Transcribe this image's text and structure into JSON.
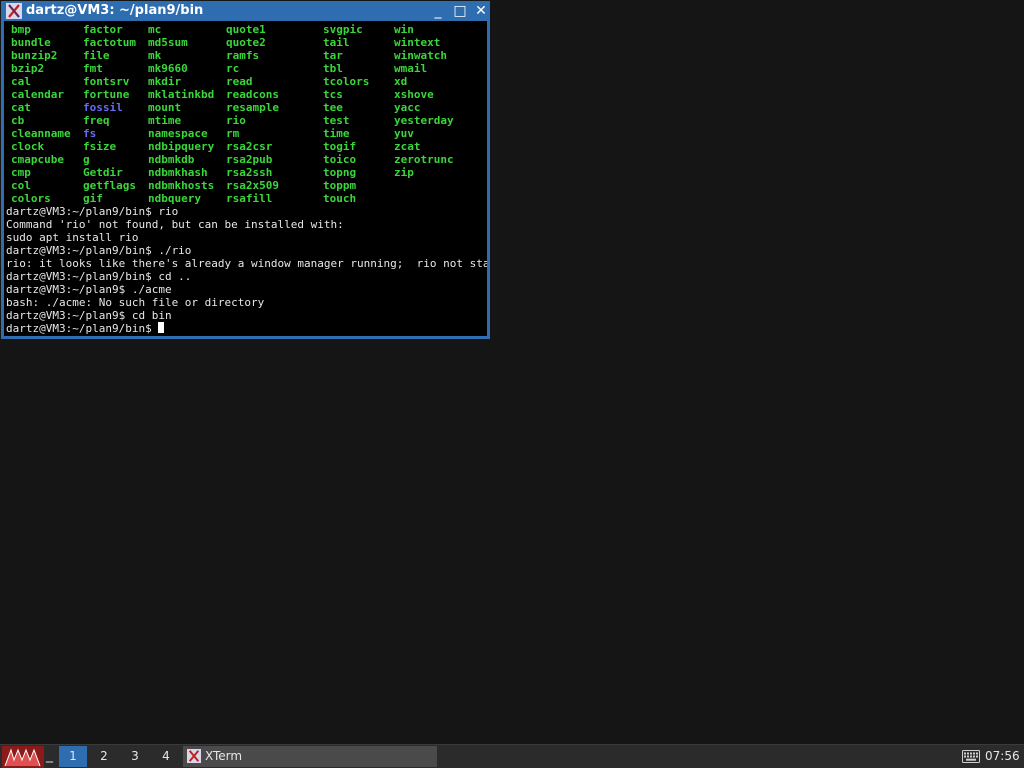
{
  "window": {
    "title": "dartz@VM3: ~/plan9/bin",
    "bg_color": "#2f6db1",
    "minimize_glyph": "_",
    "maximize_glyph": "□",
    "close_glyph": "✕"
  },
  "terminal": {
    "ls_columns": [
      [
        {
          "name": "bmp",
          "color": "#3ad63a"
        },
        {
          "name": "bundle",
          "color": "#3ad63a"
        },
        {
          "name": "bunzip2",
          "color": "#3ad63a"
        },
        {
          "name": "bzip2",
          "color": "#3ad63a"
        },
        {
          "name": "cal",
          "color": "#3ad63a"
        },
        {
          "name": "calendar",
          "color": "#3ad63a"
        },
        {
          "name": "cat",
          "color": "#3ad63a"
        },
        {
          "name": "cb",
          "color": "#3ad63a"
        },
        {
          "name": "cleanname",
          "color": "#3ad63a"
        },
        {
          "name": "clock",
          "color": "#3ad63a"
        },
        {
          "name": "cmapcube",
          "color": "#3ad63a"
        },
        {
          "name": "cmp",
          "color": "#3ad63a"
        },
        {
          "name": "col",
          "color": "#3ad63a"
        },
        {
          "name": "colors",
          "color": "#3ad63a"
        }
      ],
      [
        {
          "name": "factor",
          "color": "#3ad63a"
        },
        {
          "name": "factotum",
          "color": "#3ad63a"
        },
        {
          "name": "file",
          "color": "#3ad63a"
        },
        {
          "name": "fmt",
          "color": "#3ad63a"
        },
        {
          "name": "fontsrv",
          "color": "#3ad63a"
        },
        {
          "name": "fortune",
          "color": "#3ad63a"
        },
        {
          "name": "fossil",
          "color": "#6a6af0"
        },
        {
          "name": "freq",
          "color": "#3ad63a"
        },
        {
          "name": "fs",
          "color": "#6a6af0"
        },
        {
          "name": "fsize",
          "color": "#3ad63a"
        },
        {
          "name": "g",
          "color": "#3ad63a"
        },
        {
          "name": "Getdir",
          "color": "#3ad63a"
        },
        {
          "name": "getflags",
          "color": "#3ad63a"
        },
        {
          "name": "gif",
          "color": "#3ad63a"
        }
      ],
      [
        {
          "name": "mc",
          "color": "#3ad63a"
        },
        {
          "name": "md5sum",
          "color": "#3ad63a"
        },
        {
          "name": "mk",
          "color": "#3ad63a"
        },
        {
          "name": "mk9660",
          "color": "#3ad63a"
        },
        {
          "name": "mkdir",
          "color": "#3ad63a"
        },
        {
          "name": "mklatinkbd",
          "color": "#3ad63a"
        },
        {
          "name": "mount",
          "color": "#3ad63a"
        },
        {
          "name": "mtime",
          "color": "#3ad63a"
        },
        {
          "name": "namespace",
          "color": "#3ad63a"
        },
        {
          "name": "ndbipquery",
          "color": "#3ad63a"
        },
        {
          "name": "ndbmkdb",
          "color": "#3ad63a"
        },
        {
          "name": "ndbmkhash",
          "color": "#3ad63a"
        },
        {
          "name": "ndbmkhosts",
          "color": "#3ad63a"
        },
        {
          "name": "ndbquery",
          "color": "#3ad63a"
        }
      ],
      [
        {
          "name": "quote1",
          "color": "#3ad63a"
        },
        {
          "name": "quote2",
          "color": "#3ad63a"
        },
        {
          "name": "ramfs",
          "color": "#3ad63a"
        },
        {
          "name": "rc",
          "color": "#3ad63a"
        },
        {
          "name": "read",
          "color": "#3ad63a"
        },
        {
          "name": "readcons",
          "color": "#3ad63a"
        },
        {
          "name": "resample",
          "color": "#3ad63a"
        },
        {
          "name": "rio",
          "color": "#3ad63a"
        },
        {
          "name": "rm",
          "color": "#3ad63a"
        },
        {
          "name": "rsa2csr",
          "color": "#3ad63a"
        },
        {
          "name": "rsa2pub",
          "color": "#3ad63a"
        },
        {
          "name": "rsa2ssh",
          "color": "#3ad63a"
        },
        {
          "name": "rsa2x509",
          "color": "#3ad63a"
        },
        {
          "name": "rsafill",
          "color": "#3ad63a"
        }
      ],
      [
        {
          "name": "svgpic",
          "color": "#3ad63a"
        },
        {
          "name": "tail",
          "color": "#3ad63a"
        },
        {
          "name": "tar",
          "color": "#3ad63a"
        },
        {
          "name": "tbl",
          "color": "#3ad63a"
        },
        {
          "name": "tcolors",
          "color": "#3ad63a"
        },
        {
          "name": "tcs",
          "color": "#3ad63a"
        },
        {
          "name": "tee",
          "color": "#3ad63a"
        },
        {
          "name": "test",
          "color": "#3ad63a"
        },
        {
          "name": "time",
          "color": "#3ad63a"
        },
        {
          "name": "togif",
          "color": "#3ad63a"
        },
        {
          "name": "toico",
          "color": "#3ad63a"
        },
        {
          "name": "topng",
          "color": "#3ad63a"
        },
        {
          "name": "toppm",
          "color": "#3ad63a"
        },
        {
          "name": "touch",
          "color": "#3ad63a"
        }
      ],
      [
        {
          "name": "win",
          "color": "#3ad63a"
        },
        {
          "name": "wintext",
          "color": "#3ad63a"
        },
        {
          "name": "winwatch",
          "color": "#3ad63a"
        },
        {
          "name": "wmail",
          "color": "#3ad63a"
        },
        {
          "name": "xd",
          "color": "#3ad63a"
        },
        {
          "name": "xshove",
          "color": "#3ad63a"
        },
        {
          "name": "yacc",
          "color": "#3ad63a"
        },
        {
          "name": "yesterday",
          "color": "#3ad63a"
        },
        {
          "name": "yuv",
          "color": "#3ad63a"
        },
        {
          "name": "zcat",
          "color": "#3ad63a"
        },
        {
          "name": "zerotrunc",
          "color": "#3ad63a"
        },
        {
          "name": "zip",
          "color": "#3ad63a"
        }
      ]
    ],
    "lines": [
      "dartz@VM3:~/plan9/bin$ rio",
      "Command 'rio' not found, but can be installed with:",
      "sudo apt install rio",
      "dartz@VM3:~/plan9/bin$ ./rio",
      "rio: it looks like there's already a window manager running;  rio not started",
      "dartz@VM3:~/plan9/bin$ cd ..",
      "dartz@VM3:~/plan9$ ./acme",
      "bash: ./acme: No such file or directory",
      "dartz@VM3:~/plan9$ cd bin"
    ],
    "prompt": "dartz@VM3:~/plan9/bin$ "
  },
  "taskbar": {
    "start_icon": "start-menu-icon",
    "show_desktop_glyph": "_",
    "workspaces": [
      {
        "label": "1",
        "active": true
      },
      {
        "label": "2",
        "active": false
      },
      {
        "label": "3",
        "active": false
      },
      {
        "label": "4",
        "active": false
      }
    ],
    "task_label": "XTerm",
    "keyboard_icon": "keyboard-icon",
    "clock": "07:56"
  }
}
